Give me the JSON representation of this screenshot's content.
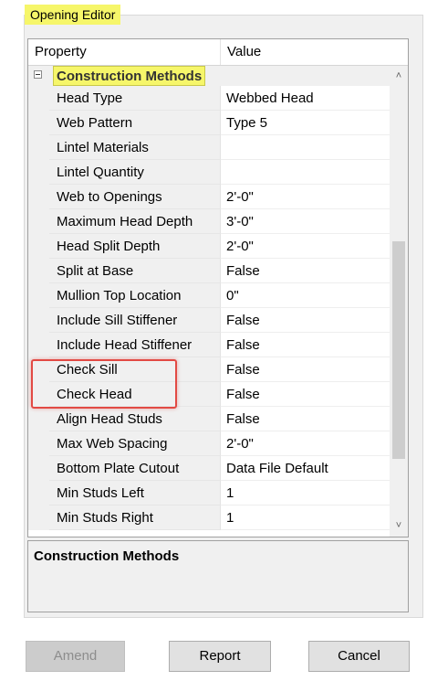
{
  "window": {
    "title": "Opening Editor"
  },
  "grid": {
    "columns": [
      "Property",
      "Value"
    ],
    "category": "Construction Methods",
    "rows": [
      {
        "property": "Head Type",
        "value": "Webbed Head"
      },
      {
        "property": "Web Pattern",
        "value": "Type 5"
      },
      {
        "property": "Lintel Materials",
        "value": ""
      },
      {
        "property": "Lintel Quantity",
        "value": ""
      },
      {
        "property": "Web to Openings",
        "value": "2'-0\""
      },
      {
        "property": "Maximum Head Depth",
        "value": "3'-0\""
      },
      {
        "property": "Head Split Depth",
        "value": "2'-0\""
      },
      {
        "property": "Split at Base",
        "value": "False"
      },
      {
        "property": "Mullion Top Location",
        "value": "0\""
      },
      {
        "property": "Include Sill Stiffener",
        "value": "False"
      },
      {
        "property": "Include Head Stiffener",
        "value": "False"
      },
      {
        "property": "Check Sill",
        "value": "False"
      },
      {
        "property": "Check Head",
        "value": "False"
      },
      {
        "property": "Align Head Studs",
        "value": "False"
      },
      {
        "property": "Max Web Spacing",
        "value": "2'-0\""
      },
      {
        "property": "Bottom Plate Cutout",
        "value": "Data File Default"
      },
      {
        "property": "Min Studs Left",
        "value": "1"
      },
      {
        "property": "Min Studs Right",
        "value": "1"
      }
    ],
    "scroll": {
      "up_glyph": "˄",
      "down_glyph": "˅"
    }
  },
  "description": {
    "title": "Construction Methods",
    "body": ""
  },
  "buttons": {
    "amend": "Amend",
    "report": "Report",
    "cancel": "Cancel"
  },
  "colors": {
    "highlight_yellow": "#f6f66a",
    "annotation_red": "#e24a44"
  },
  "states": {
    "amend_enabled": false
  }
}
